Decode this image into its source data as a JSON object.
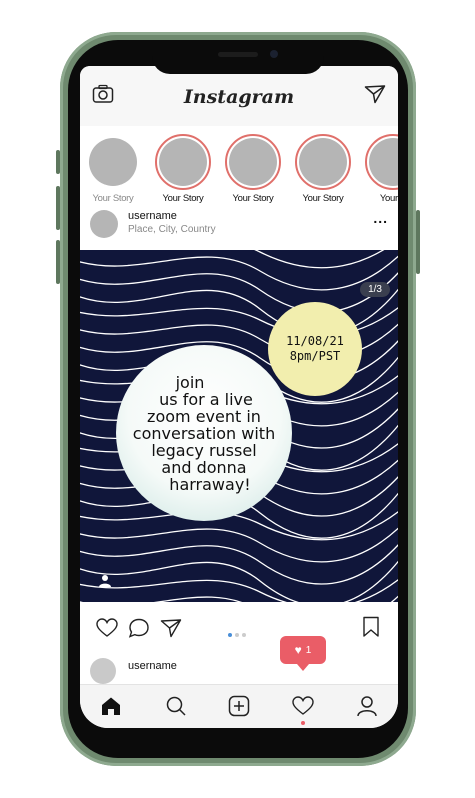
{
  "app": {
    "title": "Instagram"
  },
  "stories": [
    {
      "label": "Your Story",
      "ring": false
    },
    {
      "label": "Your Story",
      "ring": true
    },
    {
      "label": "Your Story",
      "ring": true
    },
    {
      "label": "Your Story",
      "ring": true
    },
    {
      "label": "Your S",
      "ring": true
    }
  ],
  "post": {
    "username": "username",
    "location": "Place, City,  Country",
    "more": "...",
    "counter": "1/3",
    "date_line1": "11/08/21",
    "date_line2": "8pm/PST",
    "text_lines": [
      "join",
      "us for a live",
      "zoom event in",
      "conversation with",
      "legacy russel",
      "and donna",
      "harraway!"
    ]
  },
  "next_post": {
    "username": "username"
  },
  "notification": {
    "count": "1"
  },
  "colors": {
    "accent": "#ea5d67",
    "story_ring": "#e0706b",
    "post_bg": "#10163a",
    "date_bubble": "#f2eeae",
    "dot_active": "#4a8fd8"
  },
  "icons": [
    "camera-icon",
    "send-icon",
    "heart-icon",
    "comment-icon",
    "share-icon",
    "bookmark-icon",
    "home-icon",
    "search-icon",
    "add-icon",
    "activity-icon",
    "profile-icon",
    "person-tag-icon"
  ]
}
